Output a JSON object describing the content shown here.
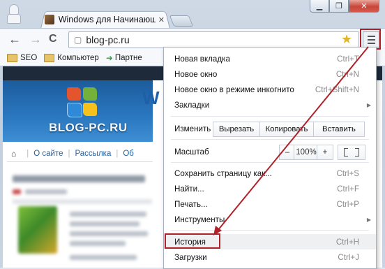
{
  "window": {
    "min_label": "▁",
    "max_label": "❐",
    "close_label": "✕"
  },
  "tab": {
    "title": "Windows для Начинающ",
    "close_label": "✕"
  },
  "toolbar": {
    "back_label": "←",
    "forward_label": "→",
    "reload_label": "C",
    "url": "blog-pc.ru"
  },
  "bookmarks": [
    {
      "label": "SEO"
    },
    {
      "label": "Компьютер"
    },
    {
      "label": "Партне"
    }
  ],
  "page": {
    "banner_text": "BLOG-PC.RU",
    "banner_partial": "W",
    "breadcrumb": [
      "О сайте",
      "Рассылка",
      "Об"
    ]
  },
  "menu": {
    "new_tab": {
      "label": "Новая вкладка",
      "shortcut": "Ctrl+T"
    },
    "new_window": {
      "label": "Новое окно",
      "shortcut": "Ctrl+N"
    },
    "incognito": {
      "label": "Новое окно в режиме инкогнито",
      "shortcut": "Ctrl+Shift+N"
    },
    "bookmarks": {
      "label": "Закладки"
    },
    "edit": {
      "label": "Изменить",
      "cut": "Вырезать",
      "copy": "Копировать",
      "paste": "Вставить"
    },
    "zoom": {
      "label": "Масштаб",
      "minus": "–",
      "value": "100%",
      "plus": "+"
    },
    "save": {
      "label": "Сохранить страницу как...",
      "shortcut": "Ctrl+S"
    },
    "find": {
      "label": "Найти...",
      "shortcut": "Ctrl+F"
    },
    "print": {
      "label": "Печать...",
      "shortcut": "Ctrl+P"
    },
    "tools": {
      "label": "Инструменты"
    },
    "history": {
      "label": "История",
      "shortcut": "Ctrl+H"
    },
    "downloads": {
      "label": "Загрузки",
      "shortcut": "Ctrl+J"
    }
  },
  "colors": {
    "highlight": "#b0222a",
    "accent_link": "#1f63a8"
  }
}
